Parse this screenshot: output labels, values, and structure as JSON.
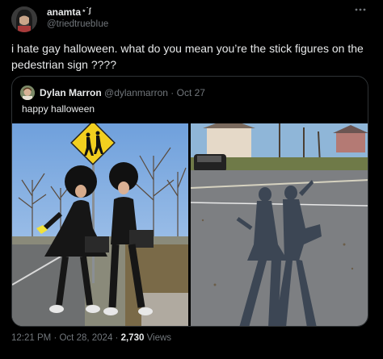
{
  "tweet": {
    "display_name": "anamta",
    "name_suffix": "⋆˙ʃ",
    "handle": "@triedtruebIue",
    "text": "i hate gay halloween. what do you mean you’re the stick figures on the pedestrian sign ????",
    "more_icon": "more-horizontal-icon"
  },
  "quoted": {
    "display_name": "Dylan Marron",
    "handle": "@dylanmarron",
    "separator": "·",
    "date": "Oct 27",
    "text": "happy halloween",
    "images": [
      {
        "description": "Two people dressed as pedestrian crossing sign stick figures standing under a yellow school-crossing sign"
      },
      {
        "description": "Shadows of the two costumed people cast on an asphalt road"
      }
    ]
  },
  "footer": {
    "time": "12:21 PM",
    "separator": "·",
    "date": "Oct 28, 2024",
    "separator2": "·",
    "views_count": "2,730",
    "views_label": "Views"
  },
  "colors": {
    "background": "#000000",
    "text_primary": "#e7e9ea",
    "text_secondary": "#71767b",
    "border": "#2f3336",
    "sign_yellow": "#f2cf1f"
  }
}
